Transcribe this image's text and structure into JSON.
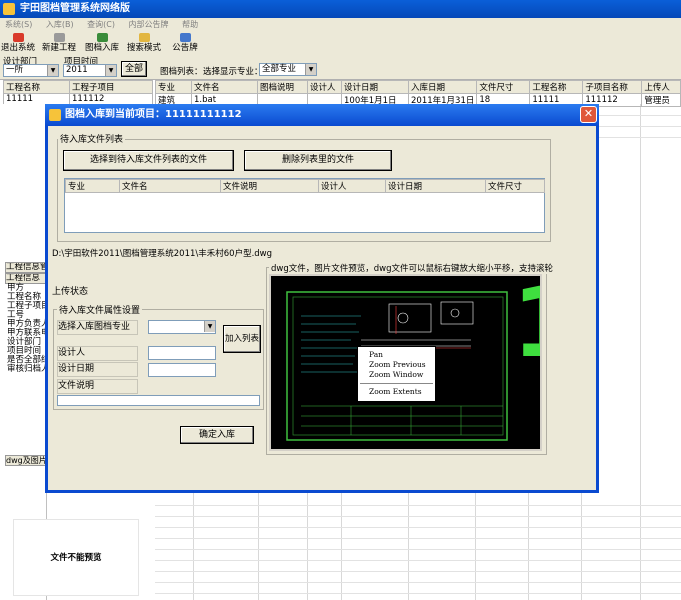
{
  "window": {
    "title": "宇田图档管理系统网络版"
  },
  "menu": [
    "系统(S)",
    "入库(B)",
    "查询(C)",
    "内部公告牌",
    "帮助"
  ],
  "toolbar": [
    {
      "label": "退出系统",
      "icon": "exit-icon",
      "color": "#d93a2a"
    },
    {
      "label": "新建工程",
      "icon": "new-project-icon",
      "color": "#9a9a9a"
    },
    {
      "label": "图档入库",
      "icon": "archive-icon",
      "color": "#3a8c3a"
    },
    {
      "label": "搜索模式",
      "icon": "search-folder-icon",
      "color": "#e2b640"
    },
    {
      "label": "公告牌",
      "icon": "notice-icon",
      "color": "#4477cc"
    }
  ],
  "filters": {
    "dept_label": "设计部门",
    "dept_value": "一所",
    "time_label": "项目时间",
    "time_value": "2011",
    "all_button": "全部",
    "list_label": "图档列表：",
    "choose_label": "选择显示专业：",
    "specialty_value": "全部专业"
  },
  "left_table": {
    "headers": [
      "工程名称",
      "工程子项目"
    ],
    "row": [
      "11111",
      "111112"
    ]
  },
  "main_table": {
    "headers": [
      "专业",
      "文件名",
      "图档说明",
      "设计人",
      "设计日期",
      "入库日期",
      "文件尺寸",
      "工程名称",
      "子项目名称",
      "上传人"
    ],
    "row": [
      "建筑",
      "1.bat",
      "",
      "",
      "100年1月1日",
      "2011年1月31日",
      "18",
      "11111",
      "111112",
      "管理员"
    ]
  },
  "info_panel": {
    "title": "工程信息管理",
    "header": "工程信息",
    "items": [
      "甲方",
      "工程名称",
      "工程子项目",
      "工号",
      "甲方负责人",
      "甲方联系电",
      "设计部门",
      "项目时间",
      "是否全部结",
      "审核归档人"
    ]
  },
  "bottom_panel": {
    "title": "dwg及图片文",
    "no_preview": "文件不能预览"
  },
  "dialog": {
    "title": "图档入库到当前项目：11111111112",
    "close": "✕",
    "pending_group": "待入库文件列表",
    "select_button": "选择到待入库文件列表的文件",
    "delete_button": "删除列表里的文件",
    "file_headers": [
      "专业",
      "文件名",
      "文件说明",
      "设计人",
      "设计日期",
      "文件尺寸"
    ],
    "path": "D:\\宇田软件2011\\图档管理系统2011\\丰禾村60户型.dwg",
    "upload_status": "上传状态",
    "preview_note": "dwg文件，图片文件预览，dwg文件可以鼠标右键放大缩小平移，支持滚轮",
    "attr_group": "待入库文件属性设置",
    "specialty_label": "选择入库图档专业",
    "designer_label": "设计人",
    "date_label": "设计日期",
    "desc_label": "文件说明",
    "add_button": "加入列表",
    "confirm_button": "确定入库",
    "big_number": "1"
  },
  "context_menu": [
    "Pan",
    "Zoom Previous",
    "Zoom Window",
    "Zoom Extents"
  ]
}
